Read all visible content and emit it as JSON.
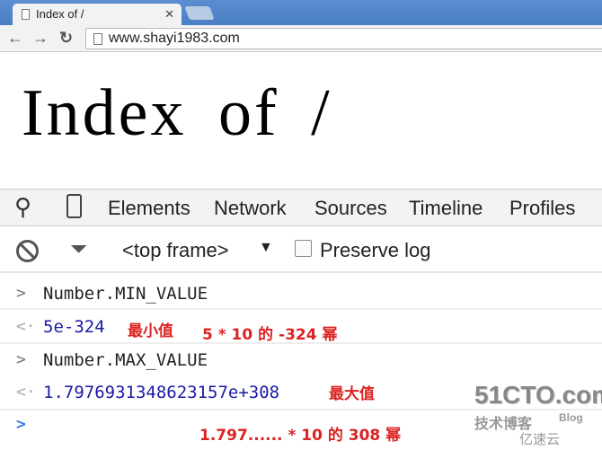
{
  "browser": {
    "tab_title": "Index of /",
    "url": "www.shayi1983.com"
  },
  "page": {
    "heading": "Index of /"
  },
  "devtools": {
    "tabs": [
      "Elements",
      "Network",
      "Sources",
      "Timeline",
      "Profiles"
    ],
    "frame_select": "<top frame>",
    "preserve_log": "Preserve log",
    "preserve_log_checked": false
  },
  "console": [
    {
      "type": "input",
      "text": "Number.MIN_VALUE"
    },
    {
      "type": "output",
      "text": "5e-324",
      "annotations": [
        "最小值",
        "5 * 10 的 -324 幂"
      ]
    },
    {
      "type": "input",
      "text": "Number.MAX_VALUE"
    },
    {
      "type": "output",
      "text": "1.7976931348623157e+308",
      "annotations": [
        "最大值"
      ]
    },
    {
      "type": "prompt",
      "annotation": "1.797...... * 10 的 308 幂"
    }
  ],
  "watermark": {
    "site": "51CTO.com",
    "sub": "技术博客",
    "blog": "Blog",
    "brand": "亿速云"
  },
  "colors": {
    "output": "#1a1aa6",
    "annotation": "#dd2222",
    "prompt": "#3b78e7"
  }
}
